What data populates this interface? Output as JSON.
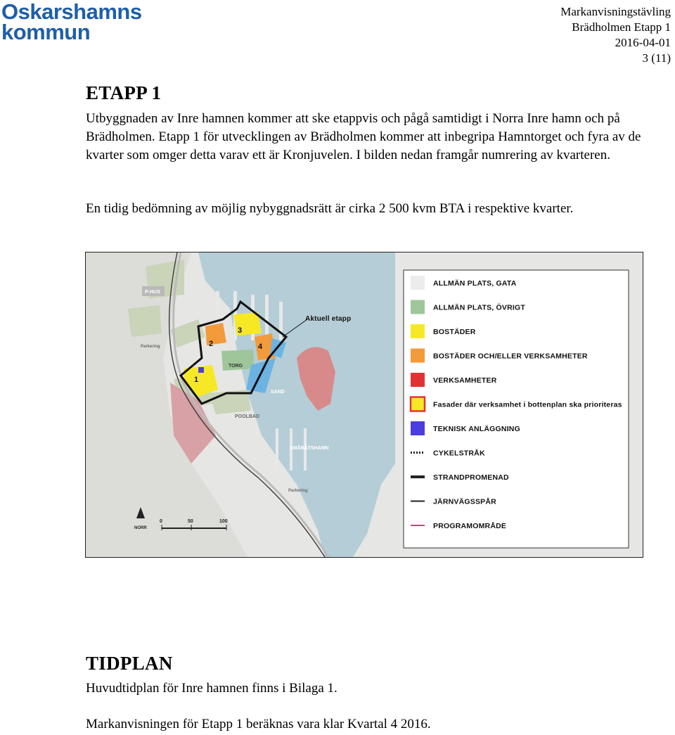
{
  "header": {
    "logo_line1": "Oskarshamns",
    "logo_line2": "kommun",
    "doc_title": "Markanvisningstävling",
    "doc_subtitle": "Brädholmen Etapp 1",
    "date": "2016-04-01",
    "page": "3 (11)"
  },
  "section1": {
    "heading": "ETAPP 1",
    "paragraph1": "Utbyggnaden av Inre hamnen kommer att ske etappvis och pågå samtidigt i Norra Inre hamn och på Brädholmen. Etapp 1 för utvecklingen av Brädholmen kommer att inbegripa Hamntorget och fyra av de kvarter som omger detta varav ett är Kronjuvelen. I bilden nedan framgår numrering av kvarteren.",
    "paragraph2": "En tidig bedömning av möjlig nybyggnadsrätt är cirka 2 500 kvm BTA i respektive kvarter."
  },
  "map": {
    "callout": "Aktuell etapp",
    "labels": {
      "phus": "P-HUS",
      "parkering1": "Parkering",
      "parkering2": "Parkering",
      "torg": "TORG",
      "sand": "SAND",
      "poolbad": "POOLBAD",
      "smabatshamn": "SMÅBÅTSHAMN",
      "norr": "NORR",
      "k1": "1",
      "k2": "2",
      "k3": "3",
      "k4": "4"
    },
    "scale": {
      "s0": "0",
      "s50": "50",
      "s100": "100"
    },
    "legend": [
      {
        "label": "ALLMÄN PLATS, GATA",
        "color": "#ececec"
      },
      {
        "label": "ALLMÄN PLATS, ÖVRIGT",
        "color": "#9fc69a"
      },
      {
        "label": "BOSTÄDER",
        "color": "#f7e826"
      },
      {
        "label": "BOSTÄDER OCH/ELLER VERKSAMHETER",
        "color": "#f39a3a"
      },
      {
        "label": "VERKSAMHETER",
        "color": "#e03434"
      },
      {
        "label": "Fasader där verksamhet i bottenplan ska prioriteras",
        "color": "#f7e826",
        "border": "#e03434"
      },
      {
        "label": "TEKNISK ANLÄGGNING",
        "color": "#4b3ee0"
      },
      {
        "label": "CYKELSTRÅK",
        "line": "dotted",
        "color": "#222222"
      },
      {
        "label": "STRANDPROMENAD",
        "line": "thick",
        "color": "#222222"
      },
      {
        "label": "JÄRNVÄGSSPÅR",
        "line": "solid",
        "color": "#222222"
      },
      {
        "label": "PROGRAMOMRÅDE",
        "line": "solid",
        "color": "#c2477c"
      }
    ]
  },
  "section2": {
    "heading": "TIDPLAN",
    "paragraph1": "Huvudtidplan för Inre hamnen finns i Bilaga 1.",
    "paragraph2": "Markanvisningen för Etapp 1 beräknas vara klar Kvartal 4 2016."
  }
}
